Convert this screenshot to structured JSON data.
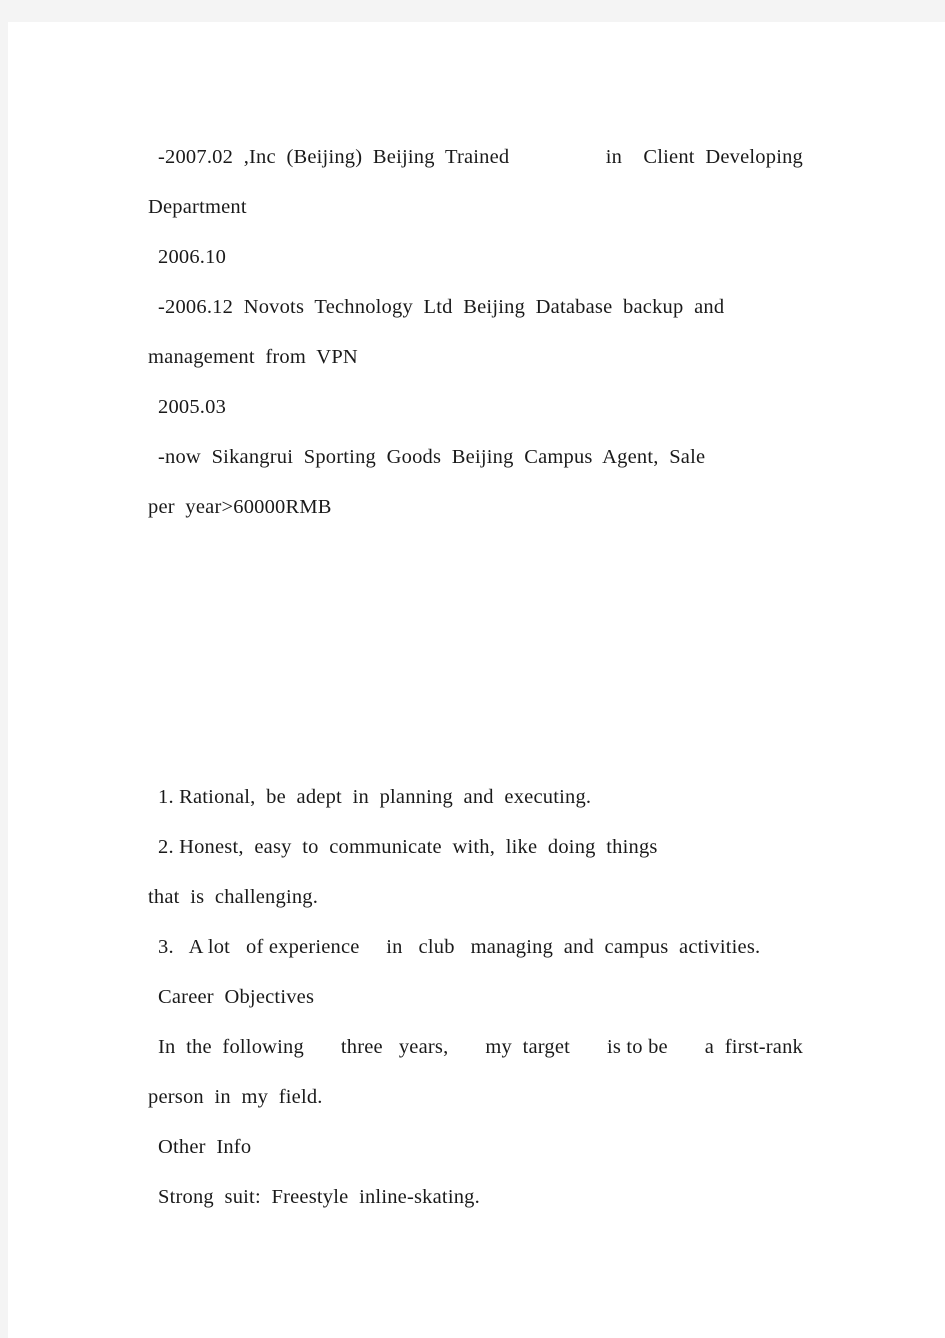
{
  "document": {
    "page_background": "#f4f4f4",
    "sheet_background": "#ffffff",
    "text_color": "#1a1a1a",
    "experience": {
      "entry_1": {
        "line_1_left": "-2007.02  ,Inc  (Beijing)  Beijing  Trained",
        "line_1_right": "in    Client  Developing",
        "line_2": "Department"
      },
      "entry_2": {
        "date_start": "2006.10",
        "line_1": "-2006.12  Novots  Technology  Ltd  Beijing  Database  backup  and",
        "line_2": "management  from  VPN"
      },
      "entry_3": {
        "date_start": "2005.03",
        "line_1": "-now  Sikangrui  Sporting  Goods  Beijing  Campus  Agent,  Sale",
        "line_2": "per  year>60000RMB"
      }
    },
    "self_assessment": {
      "item_1": "1. Rational,  be  adept  in  planning  and  executing.",
      "item_2_line_1": "2. Honest,  easy  to  communicate  with,  like  doing  things",
      "item_2_line_2": "that  is  challenging.",
      "item_3": "3.   A lot   of experience     in   club   managing  and  campus  activities."
    },
    "career_objectives": {
      "heading": "Career  Objectives",
      "line_1_left": "In  the  following",
      "line_1_mid": "three   years,",
      "line_1_right2": "my  target",
      "line_1_right3": "is to be",
      "line_1_right4": "a  first-rank",
      "line_2": "person  in  my  field."
    },
    "other_info": {
      "heading": "Other  Info",
      "line_1": "Strong  suit:  Freestyle  inline-skating."
    }
  }
}
